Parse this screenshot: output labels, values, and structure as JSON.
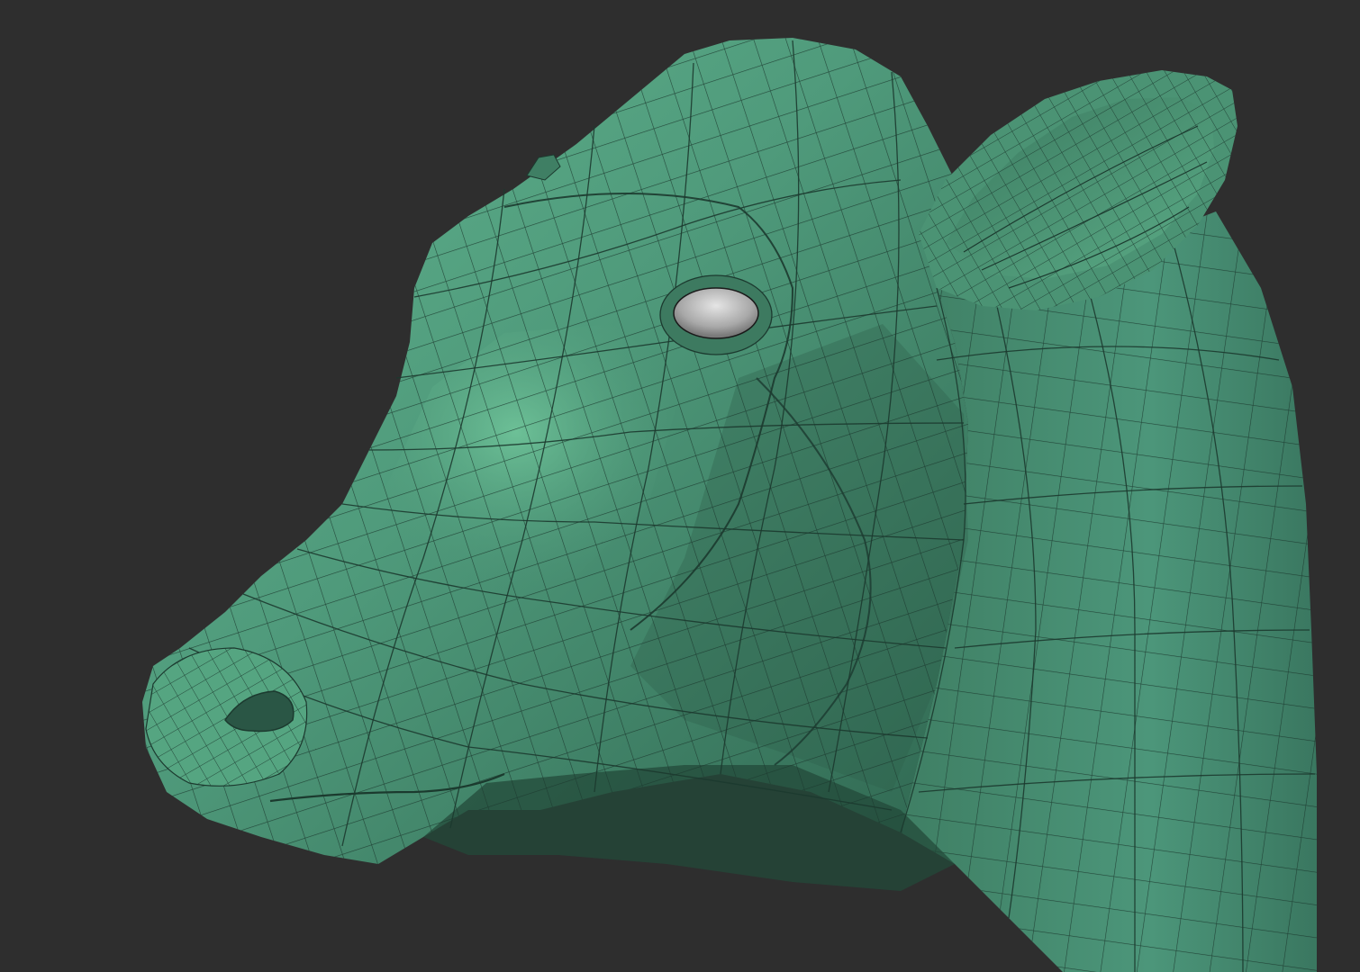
{
  "viewport": {
    "background_color": "#2e2e2e"
  },
  "model": {
    "subject": "cow head",
    "display": "wireframe-over-shaded",
    "surface_color": "#4f9a7b",
    "surface_highlight_color": "#6cc197",
    "surface_shadow_color": "#2d5e4a",
    "wire_color": "#1c3a2f",
    "eye_color": "#b9b9b9"
  },
  "icons": [
    "cow-head-model"
  ]
}
